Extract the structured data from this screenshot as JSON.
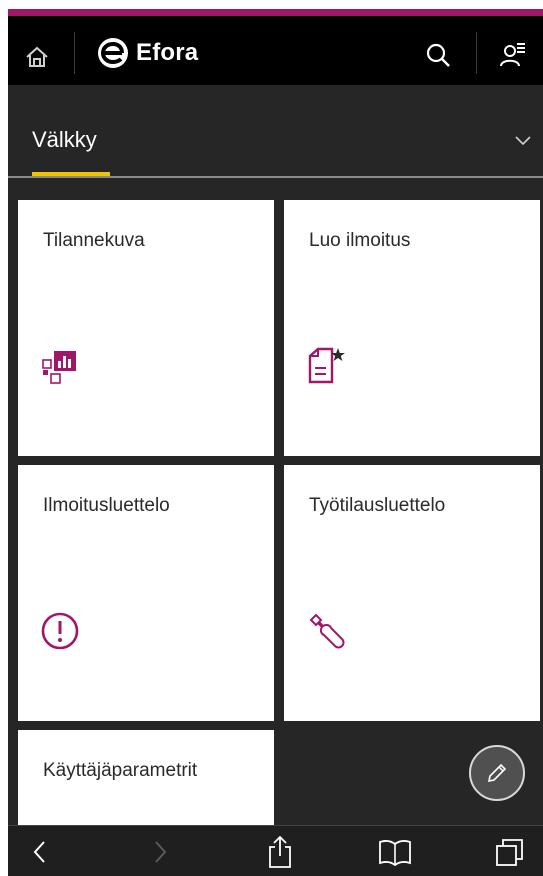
{
  "header": {
    "app_name": "Efora",
    "accent_color": "#a0176a",
    "icons": [
      "home-icon",
      "efora-logo-icon",
      "search-icon",
      "user-menu-icon"
    ]
  },
  "section": {
    "title": "Välkky",
    "underline_color": "#f0c400",
    "icon": "chevron-down-icon"
  },
  "tiles": [
    {
      "label": "Tilannekuva",
      "icon": "dashboard-chart-icon"
    },
    {
      "label": "Luo ilmoitus",
      "icon": "create-notification-icon"
    },
    {
      "label": "Ilmoitusluettelo",
      "icon": "alert-circle-icon"
    },
    {
      "label": "Työtilausluettelo",
      "icon": "wrench-icon"
    },
    {
      "label": "Käyttäjäparametrit",
      "icon": ""
    }
  ],
  "fab": {
    "icon": "pencil-icon"
  },
  "browser_toolbar": {
    "icons": [
      "back-icon",
      "forward-icon",
      "share-icon",
      "bookmarks-icon",
      "tabs-icon"
    ]
  },
  "tile_icon_color": "#a0176a"
}
